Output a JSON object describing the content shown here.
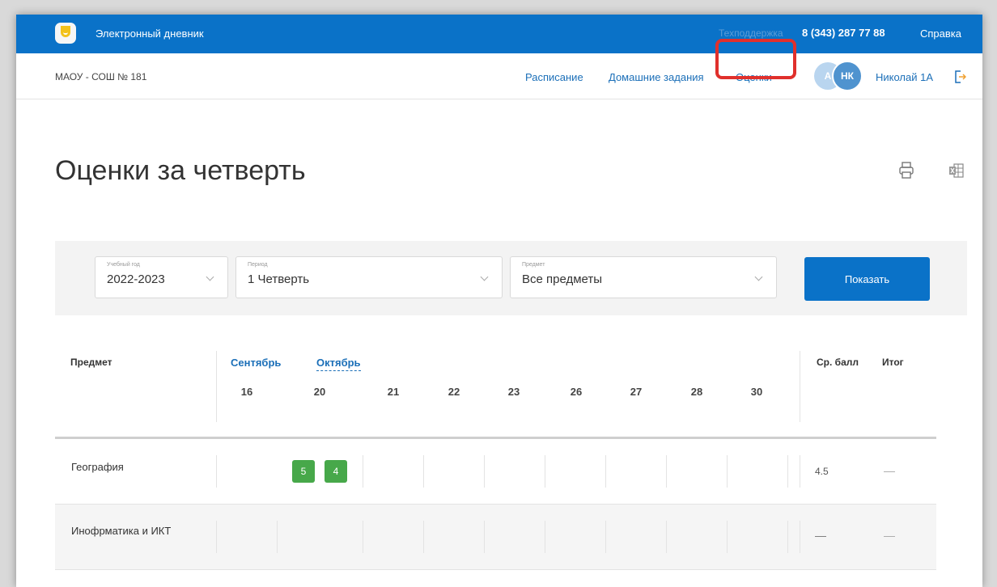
{
  "topbar": {
    "app_title": "Электронный дневник",
    "support_label": "Техподдержка",
    "support_phone": "8 (343) 287 77 88",
    "help_link": "Справка"
  },
  "navbar": {
    "school": "МАОУ - СОШ № 181",
    "links": [
      "Расписание",
      "Домашние задания",
      "Оценки"
    ],
    "avatars": [
      "А",
      "НК"
    ],
    "user_name": "Николай 1А"
  },
  "page": {
    "title": "Оценки за четверть"
  },
  "filters": {
    "year": {
      "label": "Учебный год",
      "value": "2022-2023"
    },
    "period": {
      "label": "Период",
      "value": "1 Четверть"
    },
    "subject": {
      "label": "Предмет",
      "value": "Все предметы"
    },
    "show_button": "Показать"
  },
  "table": {
    "headers": {
      "subject": "Предмет",
      "avg": "Ср. балл",
      "final": "Итог"
    },
    "months": [
      "Сентябрь",
      "Октябрь"
    ],
    "dates": [
      "16",
      "20",
      "21",
      "22",
      "23",
      "26",
      "27",
      "28",
      "30"
    ],
    "rows": [
      {
        "subject": "География",
        "grades": [
          "5",
          "4"
        ],
        "avg": "4.5",
        "final": "—"
      },
      {
        "subject": "Инофрматика и ИКТ",
        "grades": [],
        "avg": "—",
        "final": "—"
      }
    ]
  },
  "colors": {
    "primary": "#0a72c8",
    "grade_green": "#47a84a",
    "highlight_red": "#e0302c"
  }
}
